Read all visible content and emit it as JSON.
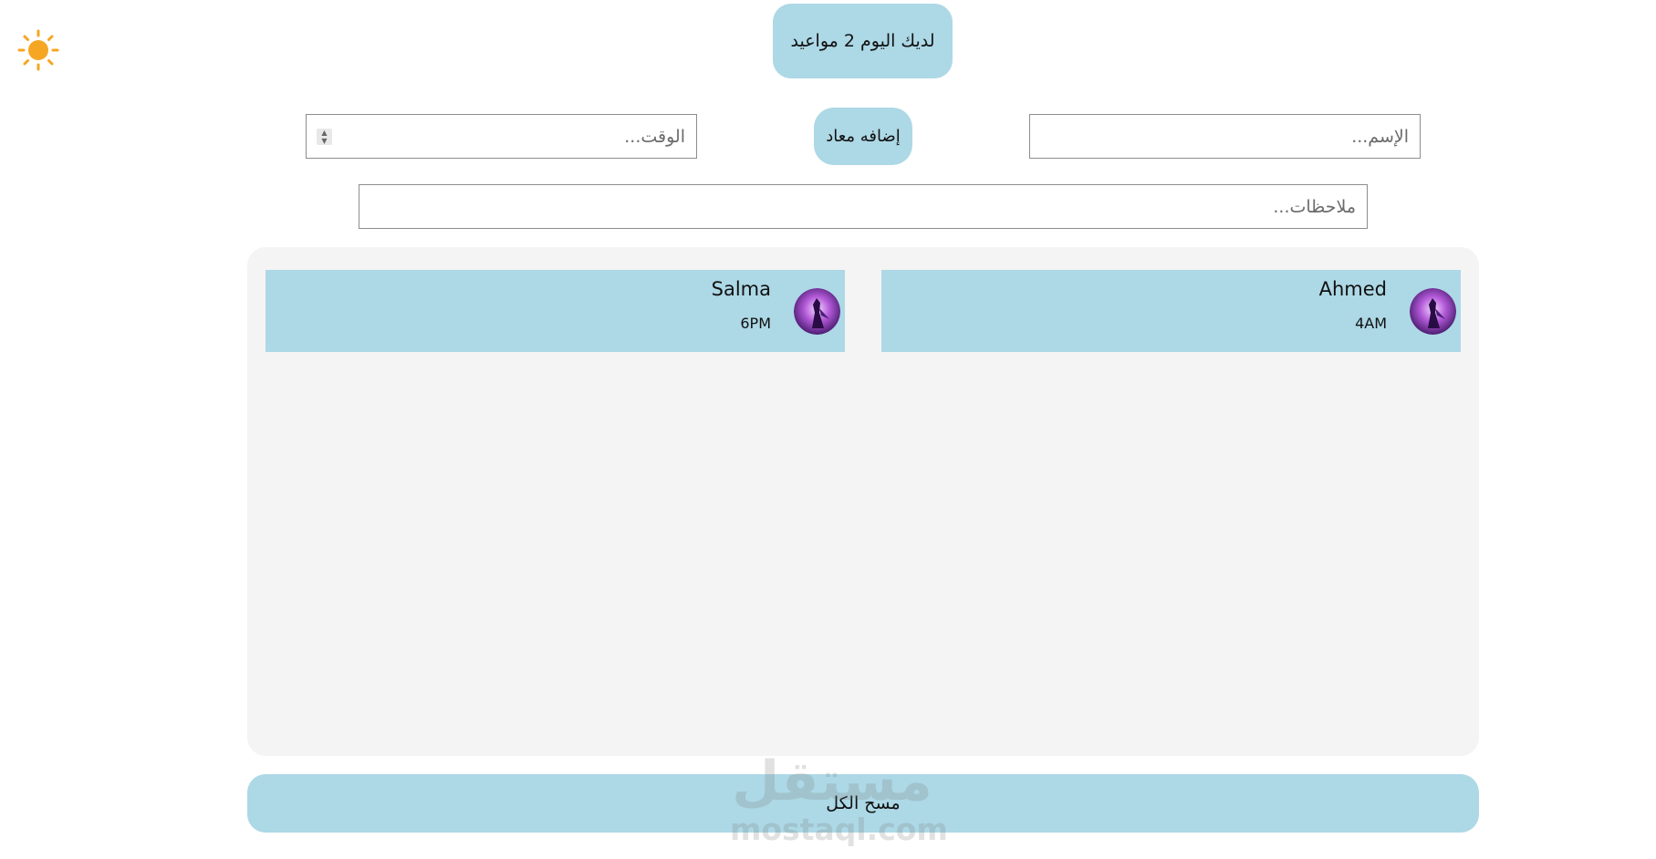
{
  "theme": {
    "accent": "#add8e6",
    "panel_bg": "#f4f4f4",
    "sun_color": "#f5a623",
    "toggle_icon": "sun-icon"
  },
  "header": {
    "summary": "لديك اليوم 2 مواعيد"
  },
  "form": {
    "name_placeholder": "الإسم...",
    "time_placeholder": "الوقت...",
    "add_label": "إضافه معاد",
    "notes_placeholder": "ملاحظات..."
  },
  "appointments": [
    {
      "name": "Ahmed",
      "time": "4AM"
    },
    {
      "name": "Salma",
      "time": "6PM"
    }
  ],
  "actions": {
    "clear_label": "مسح الكل"
  },
  "watermark": {
    "word": "مستقل",
    "url": "mostaql.com"
  }
}
